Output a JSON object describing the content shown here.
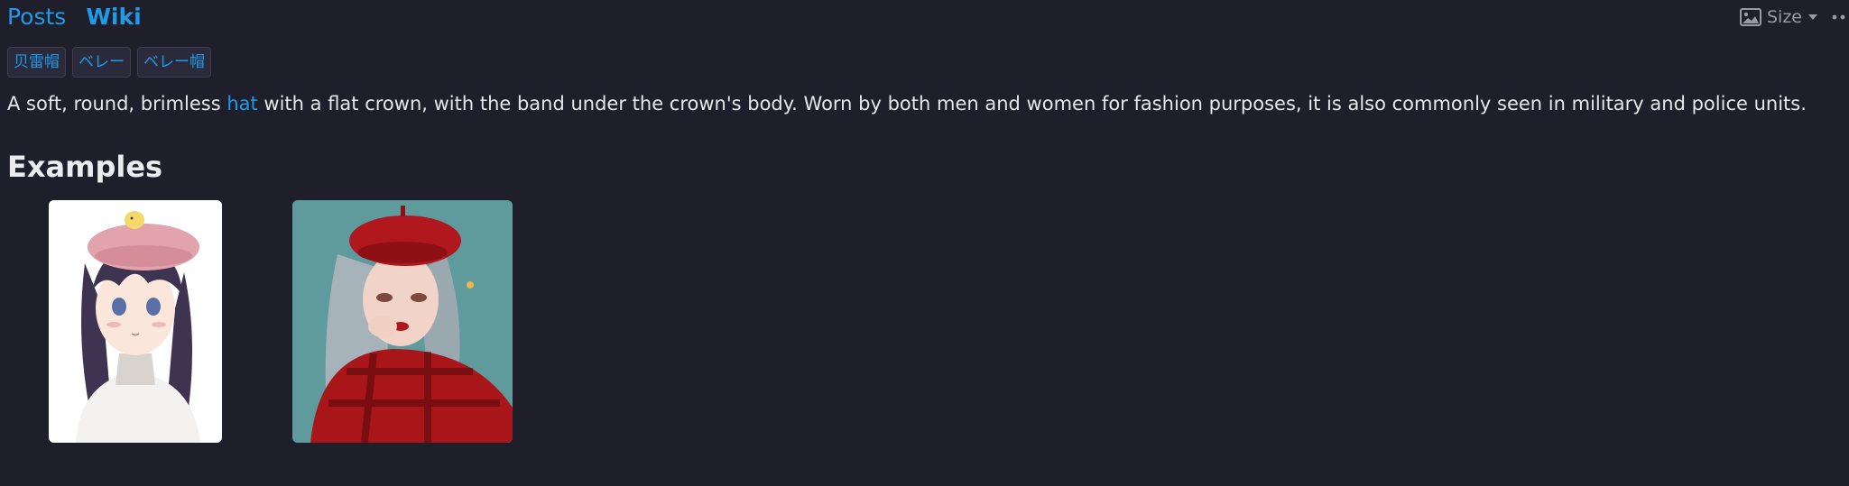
{
  "tabs": [
    {
      "label": "Posts",
      "active": false
    },
    {
      "label": "Wiki",
      "active": true
    }
  ],
  "size_control": {
    "label": "Size",
    "icon": "image-icon"
  },
  "tags": [
    "贝雷帽",
    "ベレー",
    "ベレー帽"
  ],
  "description": {
    "before": "A soft, round, brimless ",
    "link": "hat",
    "after": " with a flat crown, with the band under the crown's body. Worn by both men and women for fashion purposes, it is also commonly seen in military and police units."
  },
  "examples_heading": "Examples",
  "colors": {
    "background": "#1f1f2c",
    "link": "#1e9be8",
    "text": "#e6e6ea"
  }
}
